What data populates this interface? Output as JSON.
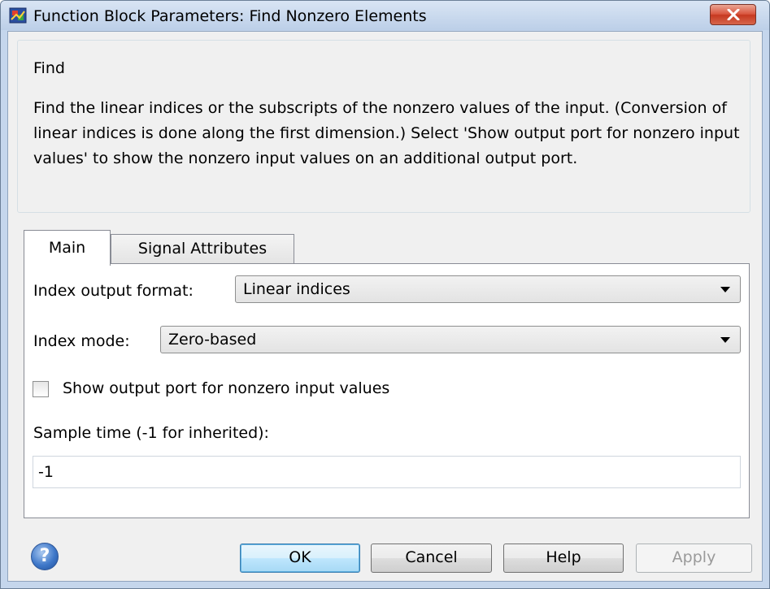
{
  "window": {
    "title": "Function Block Parameters: Find Nonzero Elements",
    "close_icon": "close-icon"
  },
  "group": {
    "legend": "Find",
    "description": "Find the linear indices or the subscripts of the nonzero values of the input. (Conversion of linear indices is done along the first dimension.) Select 'Show output port for nonzero input values' to show the nonzero input values on an additional output port."
  },
  "tabs": [
    {
      "label": "Main",
      "selected": true
    },
    {
      "label": "Signal Attributes",
      "selected": false
    }
  ],
  "main": {
    "index_output_format_label": "Index output format:",
    "index_output_format_value": "Linear indices",
    "index_mode_label": "Index mode:",
    "index_mode_value": "Zero-based",
    "show_output_port_label": "Show output port for nonzero input values",
    "show_output_port_checked": false,
    "sample_time_label": "Sample time (-1 for inherited):",
    "sample_time_value": "-1"
  },
  "buttons": {
    "help_icon_glyph": "?",
    "ok": "OK",
    "cancel": "Cancel",
    "help": "Help",
    "apply": "Apply"
  }
}
